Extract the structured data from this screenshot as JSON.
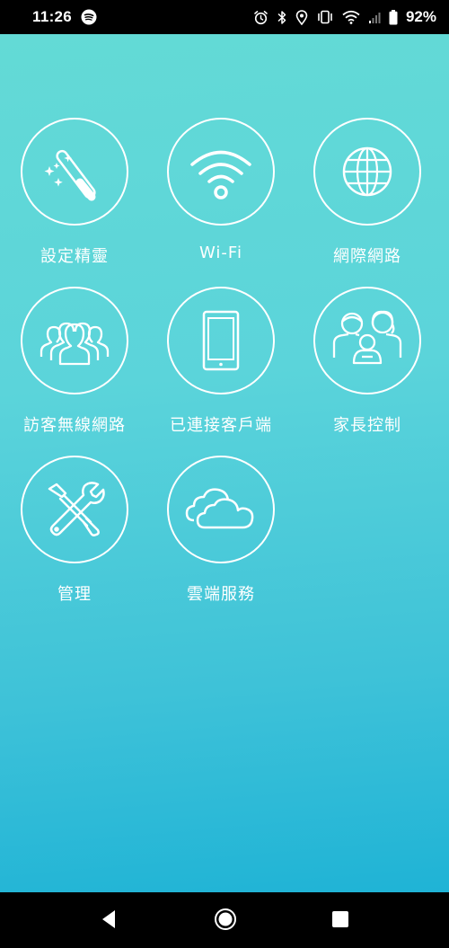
{
  "status_bar": {
    "time": "11:26",
    "battery": "92%",
    "icons": [
      "spotify-icon",
      "alarm-icon",
      "bluetooth-icon",
      "location-icon",
      "vibrate-icon",
      "wifi-signal-icon",
      "cell-signal-icon",
      "battery-icon"
    ]
  },
  "menu": {
    "items": [
      {
        "label": "設定精靈",
        "icon": "magic-wand-icon"
      },
      {
        "label": "Wi-Fi",
        "icon": "wifi-icon"
      },
      {
        "label": "網際網路",
        "icon": "globe-icon"
      },
      {
        "label": "訪客無線網路",
        "icon": "guests-icon"
      },
      {
        "label": "已連接客戶端",
        "icon": "tablet-icon"
      },
      {
        "label": "家長控制",
        "icon": "family-icon"
      },
      {
        "label": "管理",
        "icon": "tools-icon"
      },
      {
        "label": "雲端服務",
        "icon": "cloud-icon"
      }
    ]
  },
  "nav_bar": {
    "buttons": [
      "back-icon",
      "home-icon",
      "recents-icon"
    ]
  },
  "colors": {
    "gradient_top": "#63dad6",
    "gradient_bottom": "#1fb3d6",
    "foreground": "#ffffff"
  }
}
